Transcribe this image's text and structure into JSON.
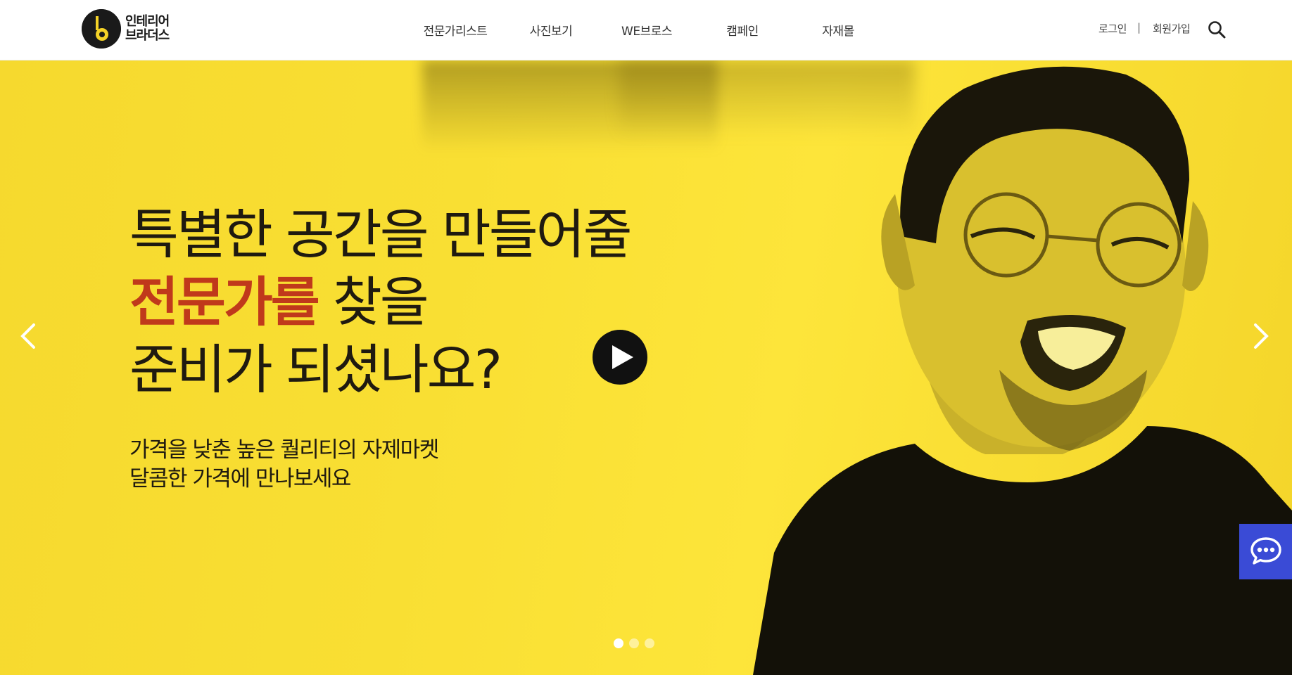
{
  "brand": {
    "logo_line1": "인테리어",
    "logo_line2": "브라더스"
  },
  "nav": {
    "items": [
      {
        "label": "전문가리스트"
      },
      {
        "label": "사진보기"
      },
      {
        "label": "WE브로스"
      },
      {
        "label": "캠페인"
      },
      {
        "label": "자재몰"
      }
    ]
  },
  "util": {
    "login": "로그인",
    "separator": "|",
    "signup": "회원가입",
    "search_icon": "search-icon"
  },
  "hero": {
    "line1": "특별한 공간을 만들어줄",
    "line2_accent": "전문가를",
    "line2_rest": " 찾을",
    "line3": "준비가 되셨나요?",
    "sub1": "가격을 낮춘 높은 퀄리티의 자제마켓",
    "sub2": "달콤한 가격에 만나보세요",
    "slides_total": 3,
    "slide_active": 1
  },
  "icons": {
    "play": "play-icon",
    "prev": "chevron-left-icon",
    "next": "chevron-right-icon",
    "chat": "chat-icon"
  },
  "colors": {
    "hero_yellow": "#f9df33",
    "accent_red": "#c0391b",
    "chat_blue": "#3a4bd6"
  }
}
